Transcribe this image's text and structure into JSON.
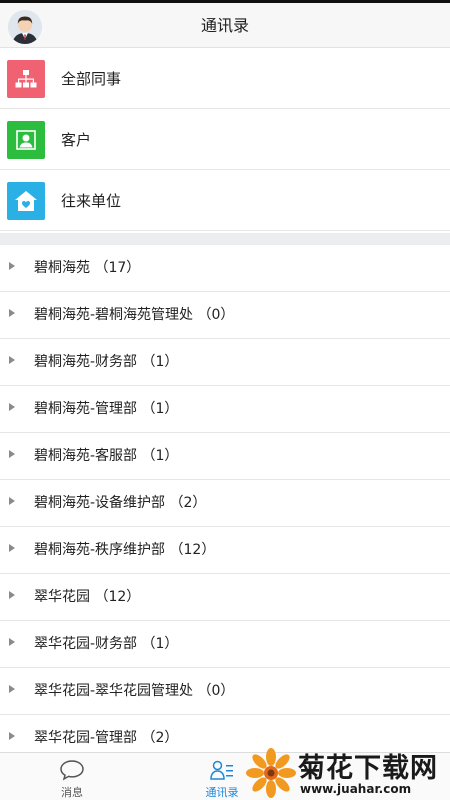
{
  "header": {
    "title": "通讯录"
  },
  "quick_links": [
    {
      "label": "全部同事",
      "icon": "org-chart-icon",
      "color": "#f06272"
    },
    {
      "label": "客户",
      "icon": "person-icon",
      "color": "#2dbd3e"
    },
    {
      "label": "往来单位",
      "icon": "house-heart-icon",
      "color": "#2ab0e4"
    }
  ],
  "groups": [
    {
      "label": "碧桐海苑 （17）"
    },
    {
      "label": "碧桐海苑-碧桐海苑管理处 （0）"
    },
    {
      "label": "碧桐海苑-财务部 （1）"
    },
    {
      "label": "碧桐海苑-管理部 （1）"
    },
    {
      "label": "碧桐海苑-客服部 （1）"
    },
    {
      "label": "碧桐海苑-设备维护部 （2）"
    },
    {
      "label": "碧桐海苑-秩序维护部 （12）"
    },
    {
      "label": "翠华花园 （12）"
    },
    {
      "label": "翠华花园-财务部 （1）"
    },
    {
      "label": "翠华花园-翠华花园管理处 （0）"
    },
    {
      "label": "翠华花园-管理部 （2）"
    }
  ],
  "tabs": [
    {
      "label": "消息",
      "icon": "chat-bubble-icon",
      "active": false
    },
    {
      "label": "通讯录",
      "icon": "contacts-icon",
      "active": true
    }
  ],
  "colors": {
    "active_tab": "#1e88d8",
    "inactive_tab": "#555555"
  },
  "watermark": {
    "title": "菊花下载网",
    "url": "www.juahar.com"
  }
}
